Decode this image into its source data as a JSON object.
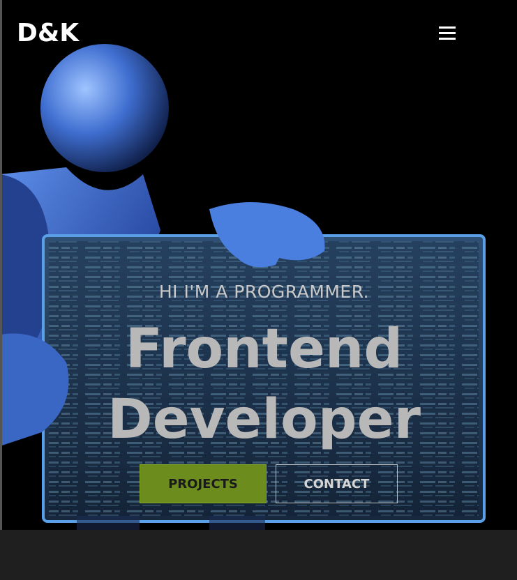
{
  "header": {
    "logo_text": "D&K",
    "menu_icon": "hamburger-menu-icon"
  },
  "hero": {
    "tagline": "HI I'M A PROGRAMMER.",
    "title_line1": "Frontend",
    "title_line2": "Developer",
    "background_image": "blue figure holding a glowing code screen",
    "buttons": {
      "projects_label": "PROJECTS",
      "contact_label": "CONTACT"
    }
  },
  "colors": {
    "background": "#000000",
    "accent_green": "#6c8d1e",
    "figure_blue": "#3a66c4",
    "bottom_band": "#1f1f1f"
  }
}
